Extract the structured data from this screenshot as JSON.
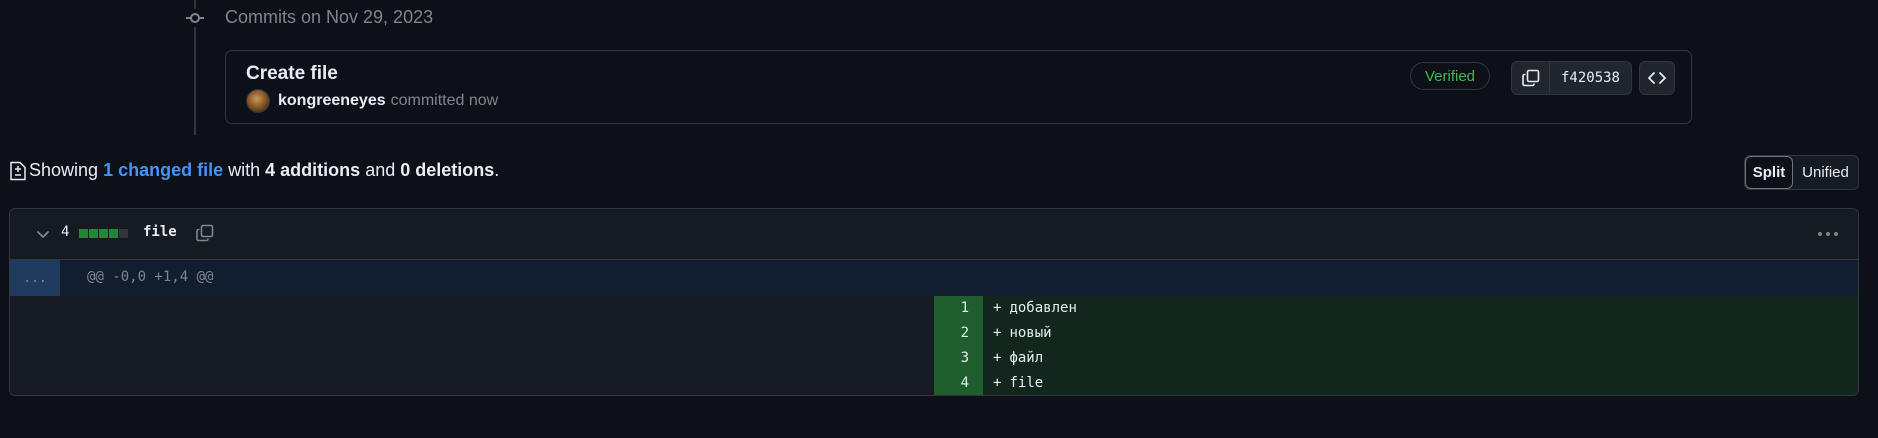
{
  "timeline": {
    "date_label": "Commits on Nov 29, 2023"
  },
  "commit": {
    "title": "Create file",
    "author": "kongreeneyes",
    "action": "committed now",
    "verified_label": "Verified",
    "sha": "f420538"
  },
  "summary": {
    "prefix": "Showing",
    "changed_files": "1 changed file",
    "with": "with",
    "additions": "4 additions",
    "and": "and",
    "deletions": "0 deletions",
    "suffix": "."
  },
  "view_toggle": {
    "split_label": "Split",
    "unified_label": "Unified",
    "selected": "Split"
  },
  "file": {
    "change_count": "4",
    "diffstat": [
      "add",
      "add",
      "add",
      "add",
      "neutral"
    ],
    "name": "file",
    "hunk_expander": "...",
    "hunk_header": "@@ -0,0 +1,4 @@",
    "lines": [
      {
        "num": "1",
        "marker": "+",
        "text": "добавлен"
      },
      {
        "num": "2",
        "marker": "+",
        "text": "новый"
      },
      {
        "num": "3",
        "marker": "+",
        "text": "файл"
      },
      {
        "num": "4",
        "marker": "+",
        "text": "file"
      }
    ]
  },
  "colors": {
    "background": "#0d1117",
    "accent_link": "#4493f8",
    "verified_green": "#3fb950",
    "addition_bg": "#12261e",
    "addition_num_bg": "#1f5c2e",
    "hunk_bg": "#121d2f",
    "diffstat_add": "#238636"
  },
  "icons": {
    "timeline_node": "git-commit-icon",
    "copy": "copy-icon",
    "browse": "code-icon",
    "diff_summary": "file-diff-icon",
    "collapse": "chevron-down-icon",
    "more": "kebab-horizontal-icon"
  }
}
